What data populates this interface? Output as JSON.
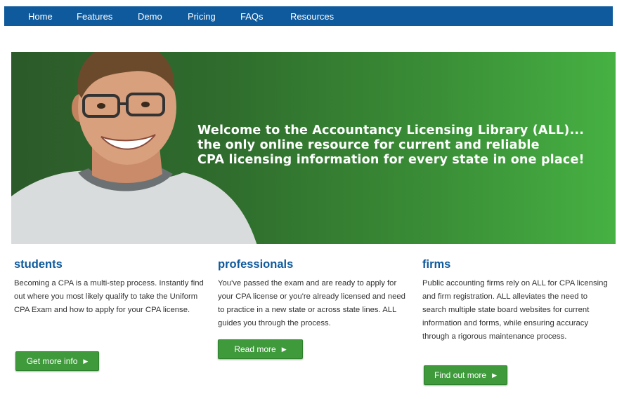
{
  "nav": {
    "items": [
      "Home",
      "Features",
      "Demo",
      "Pricing",
      "FAQs",
      "Resources"
    ]
  },
  "hero": {
    "line1": "Welcome to the Accountancy Licensing Library (ALL)...",
    "line2": "the only online resource for current and reliable",
    "line3": "CPA licensing information for every state in one place!"
  },
  "columns": [
    {
      "title": "students",
      "body": "Becoming a CPA is a multi-step process. Instantly find out where you most likely qualify to take the Uniform CPA Exam and how to apply for your CPA license.",
      "button": "Get more info"
    },
    {
      "title": "professionals",
      "body": "You've passed the exam and are ready to apply for your CPA license or you're already licensed and need to practice in a new state or across state lines. ALL guides you through the process.",
      "button": "Read more"
    },
    {
      "title": "firms",
      "body": "Public accounting firms rely on ALL for CPA licensing and firm registration. ALL alleviates the need to search multiple state board websites for current information and forms, while ensuring accuracy through a rigorous maintenance process.",
      "button": "Find out more"
    }
  ],
  "icons": {
    "button_arrow": "caret-right-icon"
  },
  "colors": {
    "nav_bg": "#0f5a9c",
    "heading": "#0f5a9c",
    "button": "#3f9a3c",
    "hero_start": "#2c5a2a",
    "hero_end": "#46b143"
  }
}
